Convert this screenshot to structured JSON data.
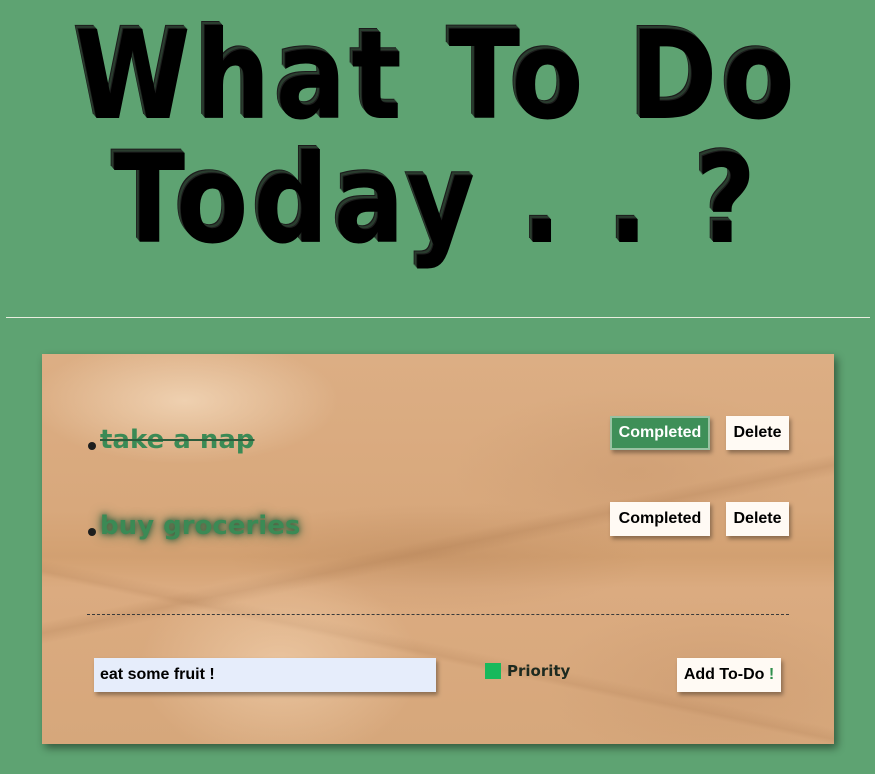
{
  "header": {
    "title_line1": "What To Do",
    "title_line2": "Today . . ?"
  },
  "todos": [
    {
      "text": "take a nap",
      "completed": true,
      "completed_label": "Completed",
      "delete_label": "Delete"
    },
    {
      "text": "buy groceries",
      "completed": false,
      "completed_label": "Completed",
      "delete_label": "Delete"
    }
  ],
  "add_form": {
    "input_value": "eat some fruit !",
    "priority_label": "Priority",
    "add_button_label": "Add To-Do",
    "add_button_suffix": "!"
  },
  "colors": {
    "background": "#5ea372",
    "accent_green": "#3e8f58",
    "priority_green": "#18b95c",
    "todo_text": "#3b8a55"
  }
}
